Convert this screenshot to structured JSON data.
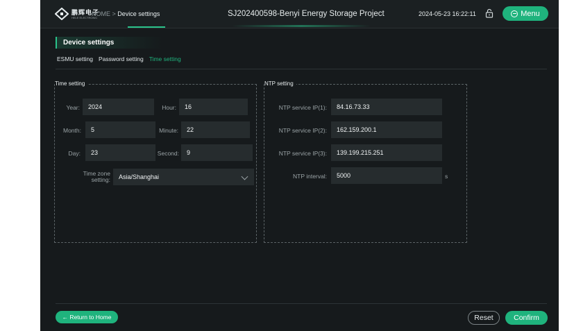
{
  "header": {
    "brand_cn": "鹏辉电子",
    "brand_en": "HELE ELECTRONIC",
    "breadcrumb_home": "HOME",
    "breadcrumb_sep": ">",
    "breadcrumb_current": "Device settings",
    "project": "SJ202400598-Benyi Energy Storage Project",
    "datetime": "2024-05-23 16:22:11",
    "menu_label": "Menu"
  },
  "section": {
    "title": "Device settings",
    "tabs": [
      {
        "label": "ESMU setting",
        "active": false
      },
      {
        "label": "Password setting",
        "active": false
      },
      {
        "label": "Time setting",
        "active": true
      }
    ]
  },
  "time_setting": {
    "title": "Time setting",
    "year_label": "Year:",
    "year": "2024",
    "month_label": "Month:",
    "month": "5",
    "day_label": "Day:",
    "day": "23",
    "hour_label": "Hour:",
    "hour": "16",
    "minute_label": "Minute:",
    "minute": "22",
    "second_label": "Second:",
    "second": "9",
    "tz_label_1": "Time zone",
    "tz_label_2": "setting:",
    "tz_value": "Asia/Shanghai"
  },
  "ntp_setting": {
    "title": "NTP setting",
    "ip1_label": "NTP service IP(1):",
    "ip1": "84.16.73.33",
    "ip2_label": "NTP service IP(2):",
    "ip2": "162.159.200.1",
    "ip3_label": "NTP service IP(3):",
    "ip3": "139.199.215.251",
    "interval_label": "NTP interval:",
    "interval": "5000",
    "interval_unit": "s"
  },
  "footer": {
    "return_label": "← Return to Home",
    "reset_label": "Reset",
    "confirm_label": "Confirm"
  },
  "colors": {
    "accent": "#1fb37d",
    "background": "#161a1c",
    "field": "#262c2e"
  },
  "icons": [
    "logo-icon",
    "lock-icon",
    "menu-icon",
    "chevron-down-icon"
  ]
}
